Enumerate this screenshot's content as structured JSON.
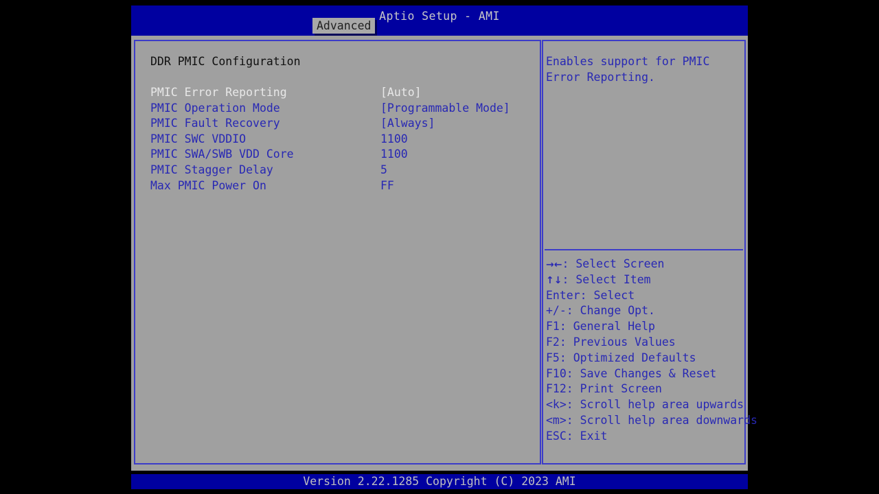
{
  "window": {
    "title": "Aptio Setup - AMI",
    "footer": "Version 2.22.1285 Copyright (C) 2023 AMI"
  },
  "tabs": [
    {
      "label": "Advanced",
      "active": true
    }
  ],
  "main": {
    "section_title": "DDR PMIC Configuration",
    "settings": [
      {
        "label": "PMIC Error Reporting",
        "value": "[Auto]",
        "selected": true
      },
      {
        "label": "PMIC Operation Mode",
        "value": "[Programmable Mode]",
        "selected": false
      },
      {
        "label": "PMIC Fault Recovery",
        "value": "[Always]",
        "selected": false
      },
      {
        "label": "PMIC SWC VDDIO",
        "value": "1100",
        "selected": false
      },
      {
        "label": "PMIC SWA/SWB VDD Core",
        "value": "1100",
        "selected": false
      },
      {
        "label": "PMIC Stagger Delay",
        "value": "5",
        "selected": false
      },
      {
        "label": "Max PMIC Power On",
        "value": "FF",
        "selected": false
      }
    ]
  },
  "help": {
    "text": "Enables support for PMIC Error Reporting.",
    "key_hints": [
      {
        "glyph": "→←",
        "text": ": Select Screen"
      },
      {
        "glyph": "↑↓",
        "text": ": Select Item"
      },
      {
        "glyph": "",
        "text": "Enter: Select"
      },
      {
        "glyph": "",
        "text": "+/-: Change Opt."
      },
      {
        "glyph": "",
        "text": "F1: General Help"
      },
      {
        "glyph": "",
        "text": "F2: Previous Values"
      },
      {
        "glyph": "",
        "text": "F5: Optimized Defaults"
      },
      {
        "glyph": "",
        "text": "F10: Save Changes & Reset"
      },
      {
        "glyph": "",
        "text": "F12: Print Screen"
      },
      {
        "glyph": "",
        "text": "<k>: Scroll help area upwards"
      },
      {
        "glyph": "",
        "text": "<m>: Scroll help area downwards"
      },
      {
        "glyph": "",
        "text": "ESC: Exit"
      }
    ]
  },
  "colors": {
    "header_blue": "#0000a0",
    "panel_gray": "#a0a0a0",
    "border_blue": "#3c3cc8",
    "text_blue": "#2828b4",
    "text_selected": "#e8e8e8",
    "tab_gray": "#a8a8a8"
  }
}
